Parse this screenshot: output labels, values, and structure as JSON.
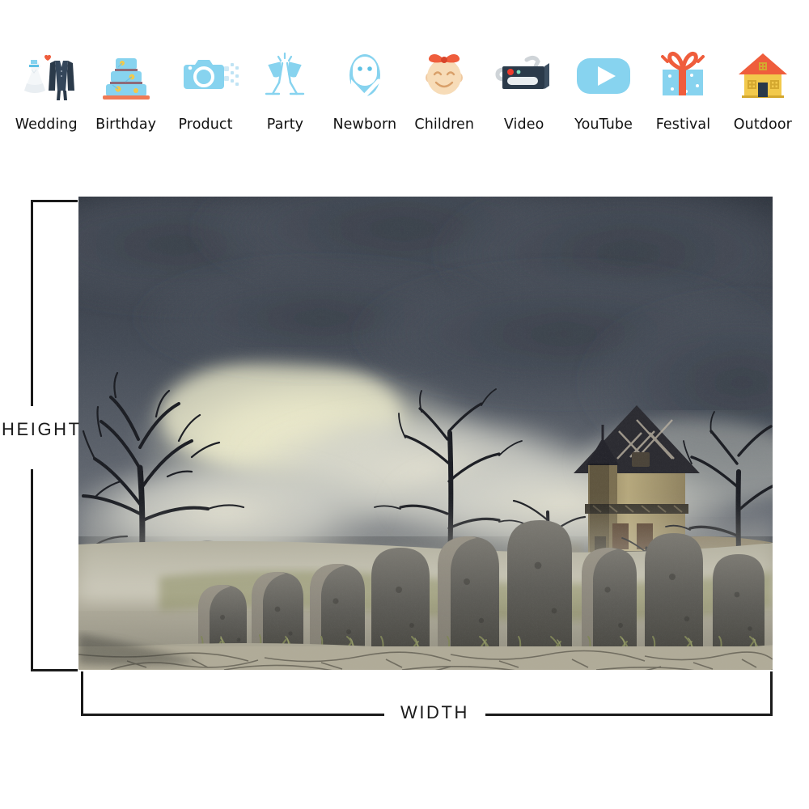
{
  "categories": {
    "items": [
      {
        "label": "Wedding",
        "icon": "wedding-dress-suit-icon"
      },
      {
        "label": "Birthday",
        "icon": "birthday-cake-icon"
      },
      {
        "label": "Product",
        "icon": "camera-icon"
      },
      {
        "label": "Party",
        "icon": "champagne-glasses-icon"
      },
      {
        "label": "Newborn",
        "icon": "swaddled-baby-icon"
      },
      {
        "label": "Children",
        "icon": "child-face-icon"
      },
      {
        "label": "Video",
        "icon": "video-camera-icon"
      },
      {
        "label": "YouTube",
        "icon": "play-button-icon"
      },
      {
        "label": "Festival",
        "icon": "gift-box-icon"
      },
      {
        "label": "Outdoor",
        "icon": "house-icon"
      }
    ]
  },
  "dimensions": {
    "height_label": "HEIGHT",
    "width_label": "WIDTH"
  },
  "photo": {
    "alt": "Halloween haunted house graveyard backdrop",
    "scene": {
      "sky_dark": "#3d444e",
      "sky_light": "#e8e6cf",
      "ground": "#b9b4a4",
      "house_wall": "#a7976f",
      "house_roof": "#2b2b31",
      "grass": "#8d8f63",
      "stone": "#6b6b68"
    }
  },
  "palette": {
    "icon_blue": "#87d3ef",
    "icon_blue_dark": "#5ec1e5",
    "icon_navy": "#2b3a4a",
    "icon_orange": "#ef5d3c",
    "icon_yellow": "#f2c94c",
    "icon_skin": "#f7dcb8",
    "line_black": "#1b1b1b",
    "text_black": "#111111"
  }
}
